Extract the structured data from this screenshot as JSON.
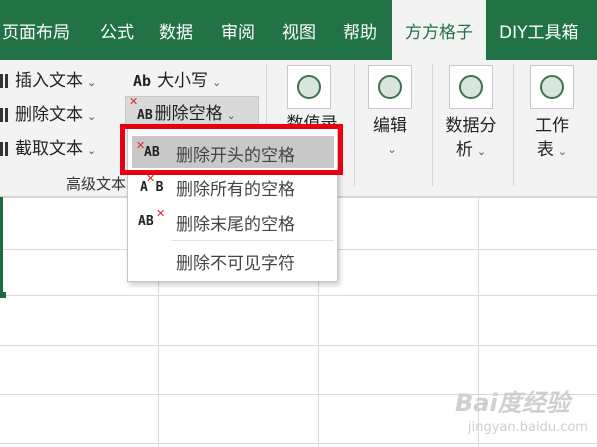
{
  "tabs": [
    {
      "label": "页面布局",
      "active": false
    },
    {
      "label": "公式",
      "active": false
    },
    {
      "label": "数据",
      "active": false
    },
    {
      "label": "审阅",
      "active": false
    },
    {
      "label": "视图",
      "active": false
    },
    {
      "label": "帮助",
      "active": false
    },
    {
      "label": "方方格子",
      "active": true
    },
    {
      "label": "DIY工具箱",
      "active": false
    }
  ],
  "ribbon": {
    "insert_text": "插入文本",
    "delete_text": "删除文本",
    "extract_text": "截取文本",
    "case_label": "大小写",
    "case_icon_text": "Ab",
    "delete_space": "删除空格",
    "ab_icon_text": "AB",
    "group_label": "高级文本",
    "number_record": "数值录",
    "edit": "编辑",
    "data_analysis_1": "数据分",
    "data_analysis_2": "析",
    "worksheet_1": "工作",
    "worksheet_2": "表"
  },
  "menu": {
    "items": [
      {
        "label": "删除开头的空格",
        "icon": "delete-leading-space-icon",
        "icon_text": "AB"
      },
      {
        "label": "删除所有的空格",
        "icon": "delete-all-space-icon",
        "icon_text": "A B"
      },
      {
        "label": "删除末尾的空格",
        "icon": "delete-trailing-space-icon",
        "icon_text": "AB"
      },
      {
        "label": "删除不可见字符",
        "icon": "",
        "icon_text": ""
      }
    ]
  },
  "watermark": {
    "main": "Bai度经验",
    "sub": "jingyan.baidu.com"
  },
  "colors": {
    "brand": "#217346",
    "highlight": "#e60012",
    "x_mark": "#e0242a"
  }
}
